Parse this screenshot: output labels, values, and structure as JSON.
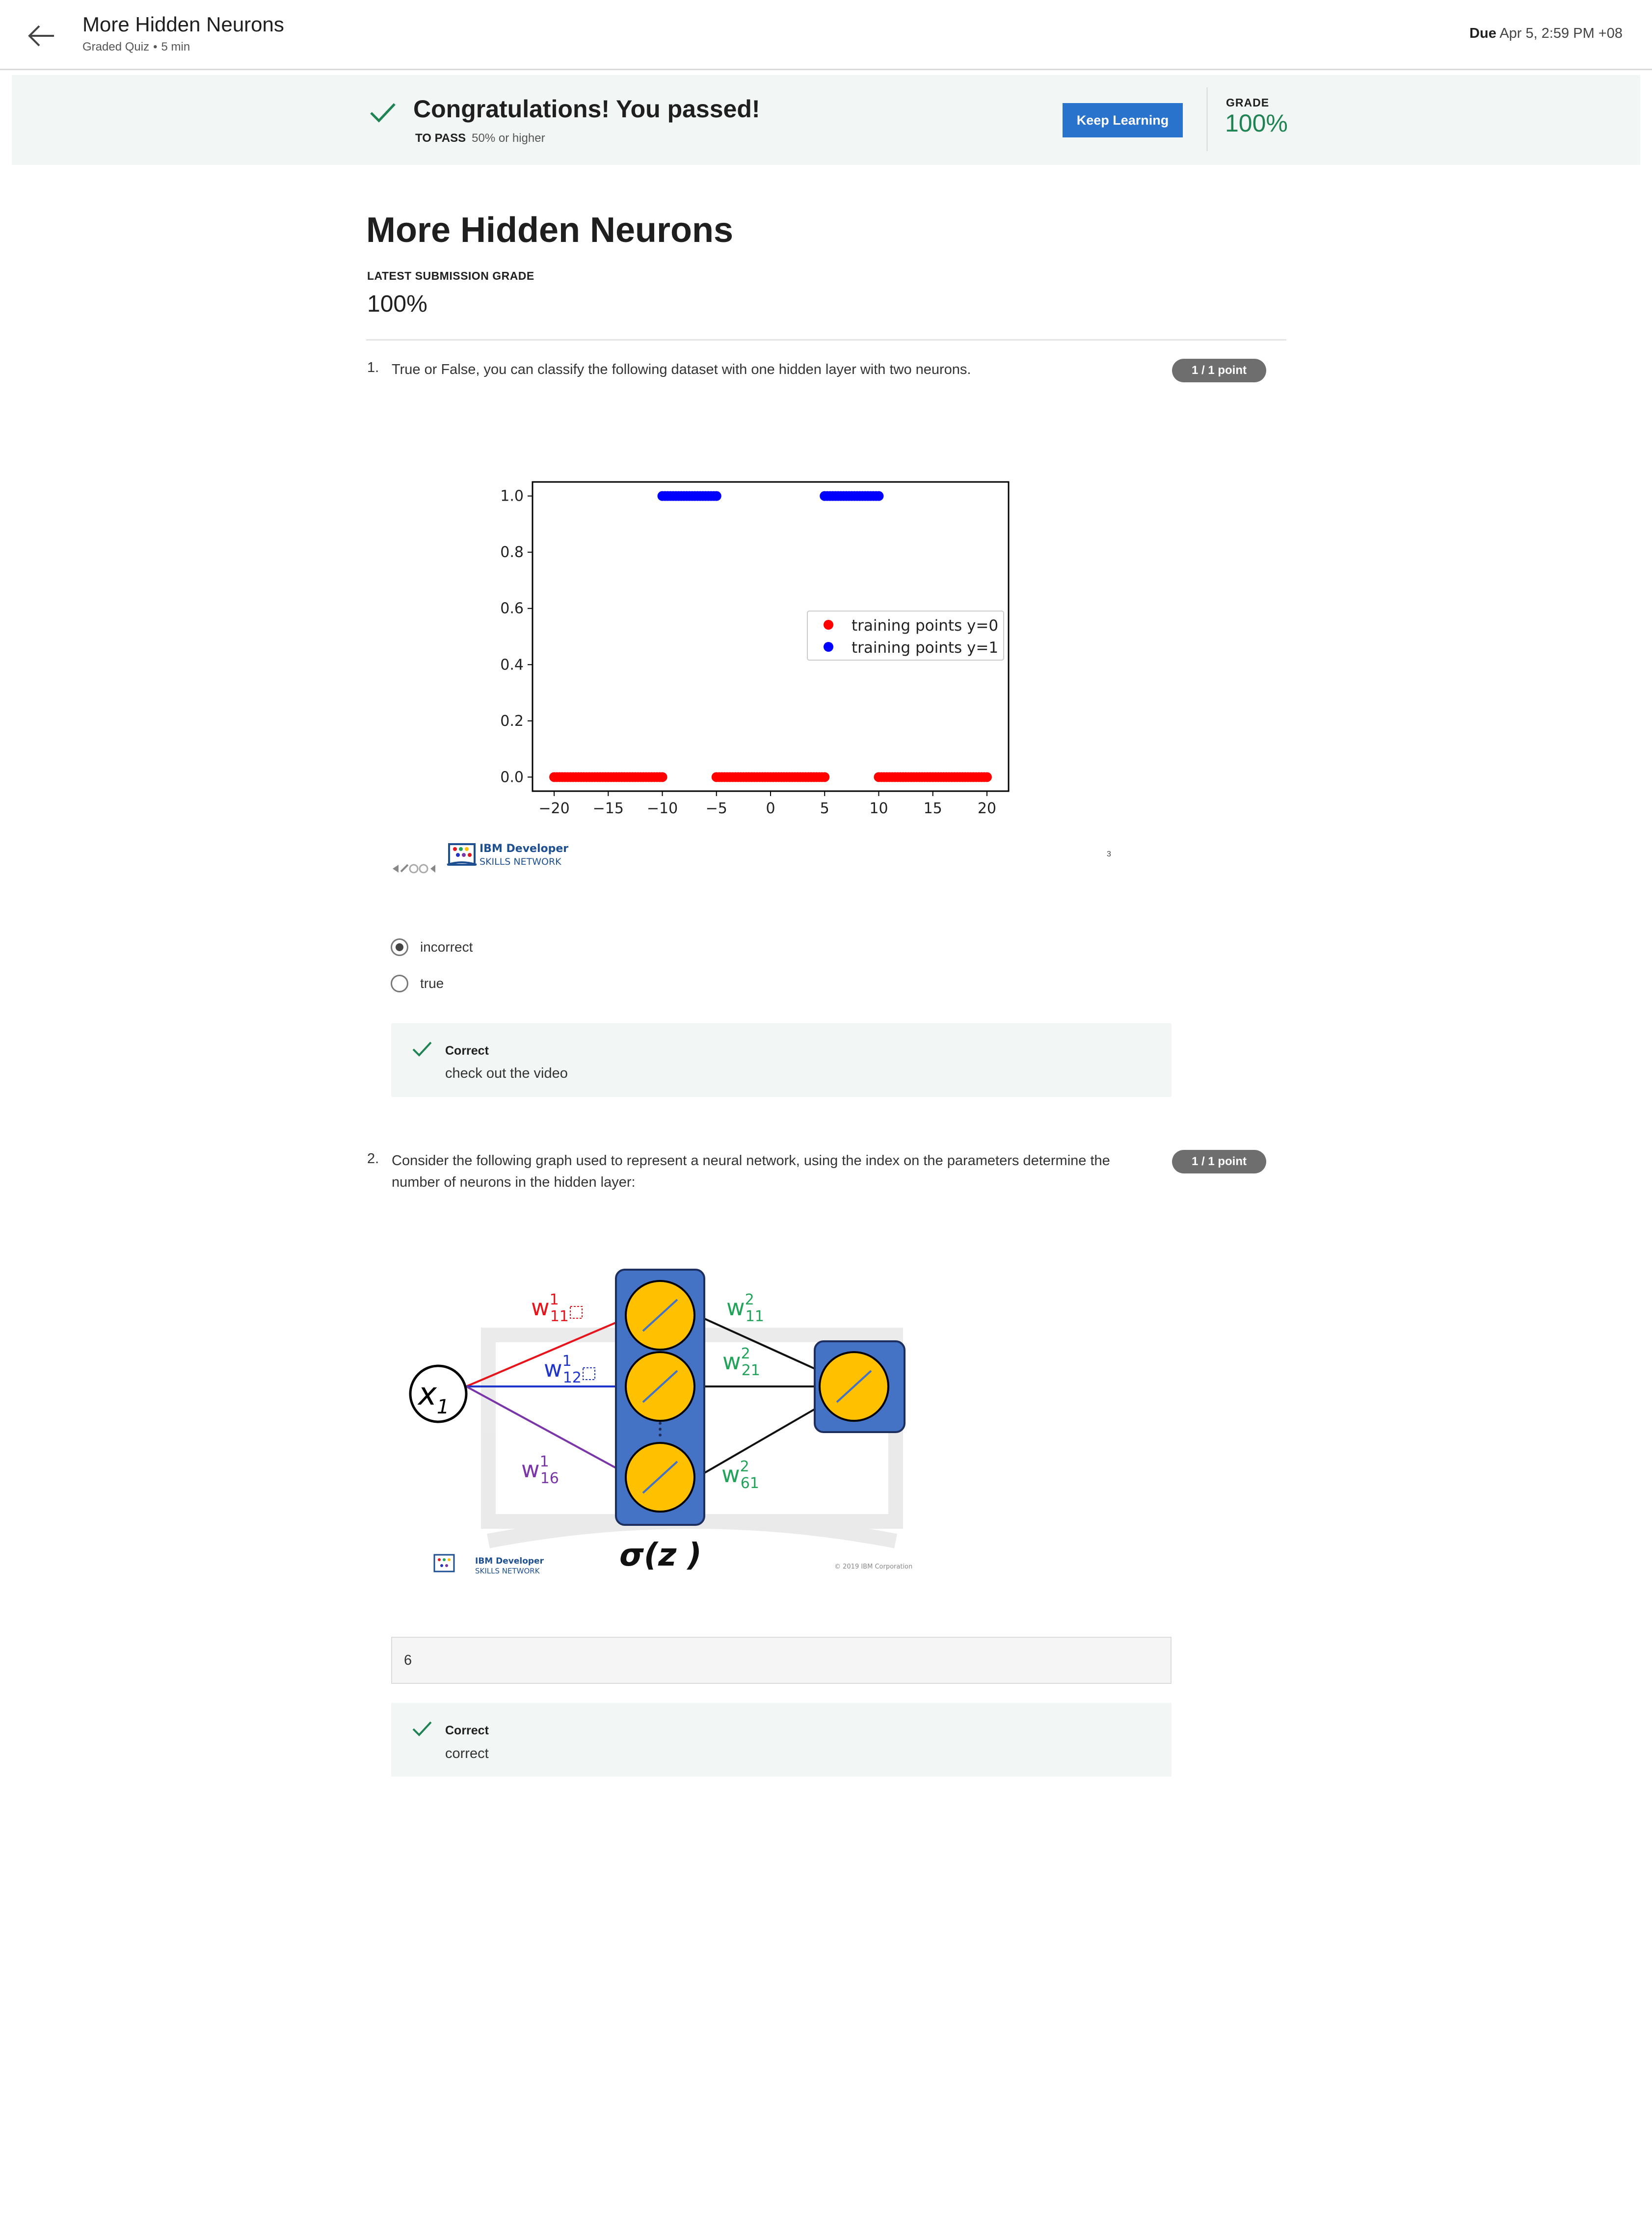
{
  "topbar": {
    "title": "More Hidden Neurons",
    "type": "Graded Quiz",
    "separator": "•",
    "duration": "5 min",
    "due_label": "Due",
    "due_value": "Apr 5, 2:59 PM +08"
  },
  "banner": {
    "message": "Congratulations! You passed!",
    "to_pass_label": "TO PASS",
    "to_pass_value": "50% or higher",
    "button": "Keep Learning",
    "grade_label": "GRADE",
    "grade_value": "100%"
  },
  "quiz": {
    "title": "More Hidden Neurons",
    "latest_label": "LATEST SUBMISSION GRADE",
    "latest_value": "100%"
  },
  "questions": [
    {
      "number": "1.",
      "text": "True or False, you can classify the following dataset with one hidden layer with two neurons.",
      "points": "1 / 1 point",
      "options": [
        {
          "label": "incorrect",
          "selected": true
        },
        {
          "label": "true",
          "selected": false
        }
      ],
      "feedback": {
        "title": "Correct",
        "text": "check out the video"
      },
      "figure": {
        "logo_line1": "IBM Developer",
        "logo_line2": "SKILLS NETWORK",
        "page_mark": "3"
      }
    },
    {
      "number": "2.",
      "text": "Consider the following graph used to represent a neural network, using the index on the parameters determine the number of neurons in the hidden layer:",
      "points": "1 / 1 point",
      "answer": "6",
      "feedback": {
        "title": "Correct",
        "text": "correct"
      },
      "figure": {
        "input_label": "x",
        "input_sub": "1",
        "activation": "σ(z )",
        "weights_layer1": [
          {
            "base": "w",
            "sup": "1",
            "sub": "11",
            "color": "#e8141c"
          },
          {
            "base": "w",
            "sup": "1",
            "sub": "12",
            "color": "#1f35c9"
          },
          {
            "base": "w",
            "sup": "1",
            "sub": "16",
            "color": "#7a35a8"
          }
        ],
        "weights_layer2": [
          {
            "base": "w",
            "sup": "2",
            "sub": "11",
            "color": "#22a35a"
          },
          {
            "base": "w",
            "sup": "2",
            "sub": "21",
            "color": "#22a35a"
          },
          {
            "base": "w",
            "sup": "2",
            "sub": "61",
            "color": "#22a35a"
          }
        ],
        "logo_line1": "IBM Developer",
        "logo_line2": "SKILLS NETWORK",
        "copyright": "© 2019 IBM Corporation"
      }
    }
  ],
  "colors": {
    "accent": "#2a73cc",
    "success": "#1f8354",
    "banner_bg": "#f2f7f5",
    "neuron_box": "#4472c4",
    "neuron_fill": "#ffc000"
  },
  "chart_data": {
    "type": "scatter",
    "xlim": [
      -22,
      22
    ],
    "ylim": [
      -0.05,
      1.05
    ],
    "xticks": [
      -20,
      -15,
      -10,
      -5,
      0,
      5,
      10,
      15,
      20
    ],
    "yticks": [
      0.0,
      0.2,
      0.4,
      0.6,
      0.8,
      1.0
    ],
    "xtick_labels": [
      "−20",
      "−15",
      "−10",
      "−5",
      "0",
      "5",
      "10",
      "15",
      "20"
    ],
    "ytick_labels": [
      "0.0",
      "0.2",
      "0.4",
      "0.6",
      "0.8",
      "1.0"
    ],
    "legend_position": "center-right",
    "grid": false,
    "series": [
      {
        "name": "training points y=0",
        "color": "#ff0000",
        "ranges": [
          [
            -20,
            -10,
            0
          ],
          [
            -5,
            5,
            0
          ],
          [
            10,
            20,
            0
          ]
        ]
      },
      {
        "name": "training points y=1",
        "color": "#0000ff",
        "ranges": [
          [
            -10,
            -5,
            1
          ],
          [
            5,
            10,
            1
          ]
        ]
      }
    ]
  }
}
